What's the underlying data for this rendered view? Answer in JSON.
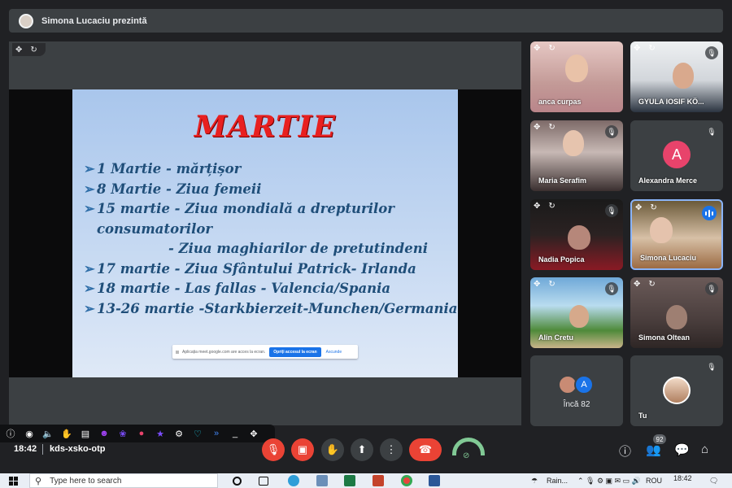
{
  "presenting": {
    "text": "Simona Lucaciu prezintă"
  },
  "slide": {
    "title": "MARTIE",
    "lines": [
      "1 Martie - mărțișor",
      "8 Martie - Ziua femeii",
      "15 martie - Ziua mondială a drepturilor",
      "consumatorilor",
      "- Ziua maghiarilor de pretutindeni",
      "17 martie - Ziua Sfântului Patrick- Irlanda",
      "18 martie - Las fallas - Valencia/Spania",
      "13-26 martie -Starkbierzeit-Munchen/Germania"
    ],
    "share_notice": {
      "text": "Aplicația meet.google.com are acces la ecran.",
      "stop_label": "Opriți accesul la ecran",
      "hide_label": "Ascunde"
    }
  },
  "participants": [
    {
      "name": "anca curpas"
    },
    {
      "name": "GYULA IOSIF KÖ..."
    },
    {
      "name": "Maria Serafim"
    },
    {
      "name": "Alexandra Merce",
      "initial": "A"
    },
    {
      "name": "Nadia Popica"
    },
    {
      "name": "Simona Lucaciu"
    },
    {
      "name": "Alin Cretu"
    },
    {
      "name": "Simona Oltean"
    }
  ],
  "more": {
    "label": "Încă 82",
    "avatar_letter": "A"
  },
  "self": {
    "name": "Tu"
  },
  "meeting": {
    "time": "18:42",
    "code": "kds-xsko-otp"
  },
  "people_count": "92",
  "taskbar": {
    "search_placeholder": "Type here to search",
    "weather": "Rain...",
    "lang": "ROU",
    "clock": "18:42"
  },
  "colors": {
    "end_call": "#ea4335",
    "active_border": "#8ab4f8",
    "slide_title": "#e82020"
  }
}
